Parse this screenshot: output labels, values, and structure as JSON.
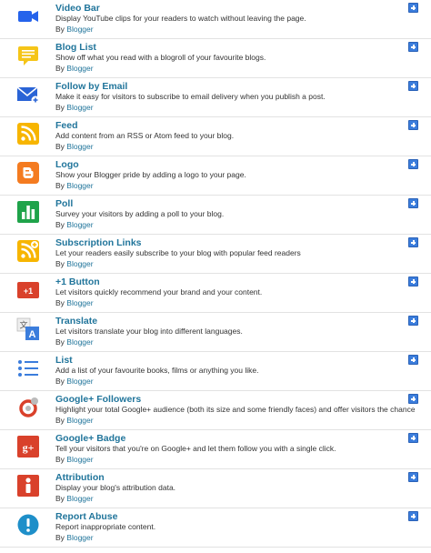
{
  "gadgets": [
    {
      "title": "Video Bar",
      "description": "Display YouTube clips for your readers to watch without leaving the page.",
      "by": "By",
      "author": "Blogger",
      "icon": "video-camera-icon",
      "color": "#2563eb"
    },
    {
      "title": "Blog List",
      "description": "Show off what you read with a blogroll of your favourite blogs.",
      "by": "By",
      "author": "Blogger",
      "icon": "blog-list-icon",
      "color": "#f5c518"
    },
    {
      "title": "Follow by Email",
      "description": "Make it easy for visitors to subscribe to email delivery when you publish a post.",
      "by": "By",
      "author": "Blogger",
      "icon": "email-icon",
      "color": "#2a64d6"
    },
    {
      "title": "Feed",
      "description": "Add content from an RSS or Atom feed to your blog.",
      "by": "By",
      "author": "Blogger",
      "icon": "rss-icon",
      "color": "#f7b500"
    },
    {
      "title": "Logo",
      "description": "Show your Blogger pride by adding a logo to your page.",
      "by": "By",
      "author": "Blogger",
      "icon": "blogger-logo-icon",
      "color": "#f47b20"
    },
    {
      "title": "Poll",
      "description": "Survey your visitors by adding a poll to your blog.",
      "by": "By",
      "author": "Blogger",
      "icon": "poll-icon",
      "color": "#1fa34a"
    },
    {
      "title": "Subscription Links",
      "description": "Let your readers easily subscribe to your blog with popular feed readers",
      "by": "By",
      "author": "Blogger",
      "icon": "subscription-rss-icon",
      "color": "#f7b500"
    },
    {
      "title": "+1 Button",
      "description": "Let visitors quickly recommend your brand and your content.",
      "by": "By",
      "author": "Blogger",
      "icon": "plus-one-icon",
      "color": "#d9412b"
    },
    {
      "title": "Translate",
      "description": "Let visitors translate your blog into different languages.",
      "by": "By",
      "author": "Blogger",
      "icon": "translate-icon",
      "color": "#3b7ddc"
    },
    {
      "title": "List",
      "description": "Add a list of your favourite books, films or anything you like.",
      "by": "By",
      "author": "Blogger",
      "icon": "list-icon",
      "color": "#3b7ddc"
    },
    {
      "title": "Google+ Followers",
      "description": "Highlight your total Google+ audience (both its size and some friendly faces) and offer visitors the chance to follow you on Google+.",
      "by": "By",
      "author": "Blogger",
      "icon": "google-plus-followers-icon",
      "color": "#d9412b"
    },
    {
      "title": "Google+ Badge",
      "description": "Tell your visitors that you're on Google+ and let them follow you with a single click.",
      "by": "By",
      "author": "Blogger",
      "icon": "google-plus-badge-icon",
      "color": "#d9412b"
    },
    {
      "title": "Attribution",
      "description": "Display your blog's attribution data.",
      "by": "By",
      "author": "Blogger",
      "icon": "attribution-icon",
      "color": "#d9412b"
    },
    {
      "title": "Report Abuse",
      "description": "Report inappropriate content.",
      "by": "By",
      "author": "Blogger",
      "icon": "report-abuse-icon",
      "color": "#1e8fc9"
    }
  ]
}
